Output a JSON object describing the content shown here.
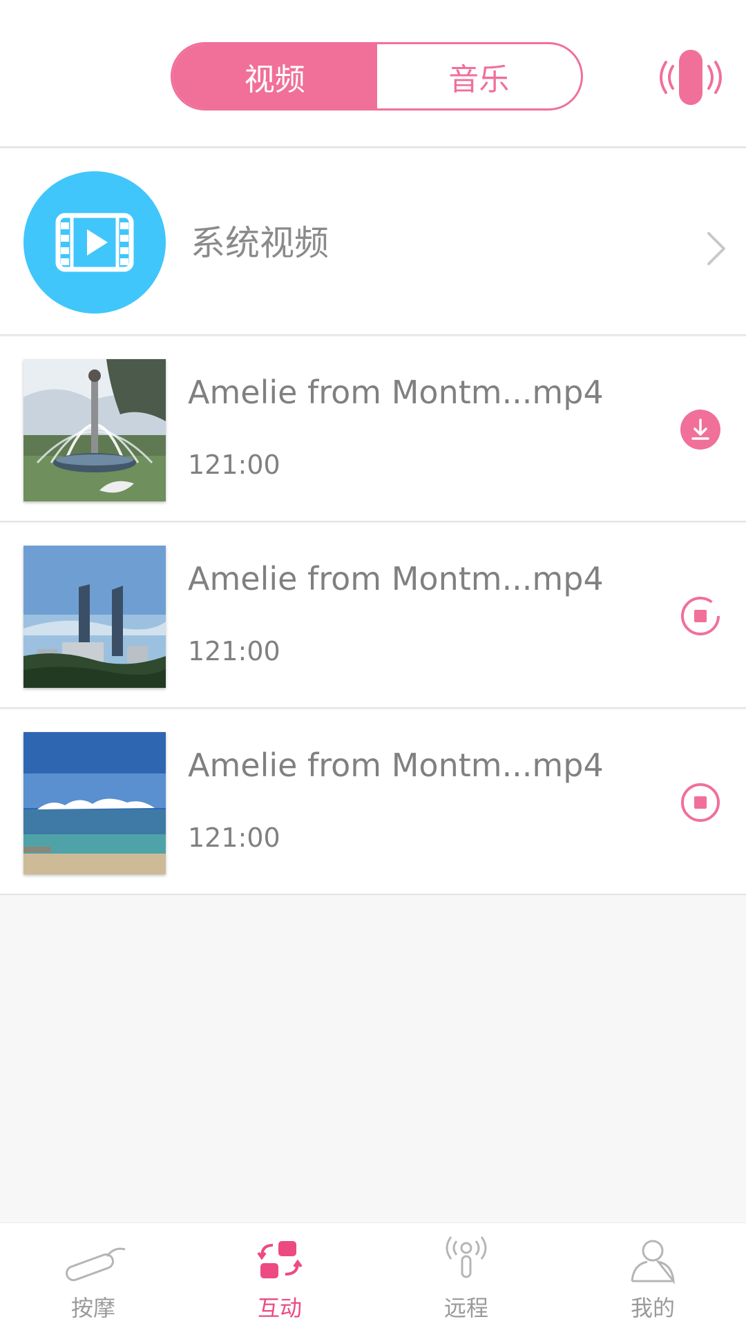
{
  "header": {
    "tabs": [
      {
        "label": "视频",
        "active": true
      },
      {
        "label": "音乐",
        "active": false
      }
    ],
    "right_icon": "vibrator-signal-icon"
  },
  "system_video": {
    "title": "系统视频",
    "icon": "film-play-icon"
  },
  "videos": [
    {
      "title": "Amelie from Montm...mp4",
      "duration": "121:00",
      "thumbnail": "fountain",
      "action_icon": "download-icon"
    },
    {
      "title": "Amelie from Montm...mp4",
      "duration": "121:00",
      "thumbnail": "twin-towers",
      "action_icon": "stop-loading-icon"
    },
    {
      "title": "Amelie from Montm...mp4",
      "duration": "121:00",
      "thumbnail": "beach",
      "action_icon": "stop-icon"
    }
  ],
  "bottom_nav": [
    {
      "label": "按摩",
      "icon": "massager-icon",
      "active": false
    },
    {
      "label": "互动",
      "icon": "interact-icon",
      "active": true
    },
    {
      "label": "远程",
      "icon": "remote-signal-icon",
      "active": false
    },
    {
      "label": "我的",
      "icon": "user-icon",
      "active": false
    }
  ],
  "colors": {
    "accent": "#f07099",
    "accent_dark": "#ec4a83",
    "system_blue": "#40c6fb",
    "text_gray": "#808080"
  }
}
